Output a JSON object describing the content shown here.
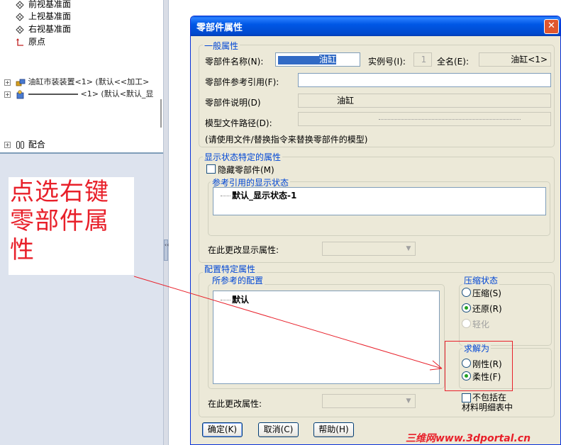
{
  "feature_tree": {
    "items": [
      {
        "label": "前视基准面",
        "icon": "plane-icon"
      },
      {
        "label": "上视基准面",
        "icon": "plane-icon"
      },
      {
        "label": "右视基准面",
        "icon": "plane-icon"
      },
      {
        "label": "原点",
        "icon": "origin-icon"
      }
    ],
    "partial_rows": [
      "油缸市装装置<1> (默认<<加工>",
      "<1> (默认<默认_显"
    ],
    "mates_label": "配合"
  },
  "annotation": {
    "text": "点选右键零部件属性",
    "color": "#e8202a"
  },
  "watermark": "三维网www.3dportal.cn",
  "dialog": {
    "title": "零部件属性",
    "general": {
      "legend": "一般属性",
      "name_label": "零部件名称(N):",
      "name_value": "油缸",
      "instance_label": "实例号(I):",
      "instance_value": "1",
      "fullname_label": "全名(E):",
      "fullname_value": "油缸<1>",
      "ref_label": "零部件参考引用(F):",
      "ref_value": "",
      "desc_label": "零部件说明(D)",
      "desc_value": "油缸",
      "path_label": "模型文件路径(D):",
      "path_value": "",
      "note": "(请使用文件/替换指令来替换零部件的模型)"
    },
    "display_state": {
      "legend": "显示状态特定的属性",
      "hide_label": "隐藏零部件(M)",
      "hide_checked": false,
      "ref_list_legend": "参考引用的显示状态",
      "ref_list_items": [
        "默认_显示状态-1"
      ],
      "change_label": "在此更改显示属性:"
    },
    "config": {
      "legend": "配置特定属性",
      "ref_configs_legend": "所参考的配置",
      "ref_configs_items": [
        "默认"
      ],
      "suppress": {
        "legend": "压缩状态",
        "options": [
          {
            "label": "压缩(S)",
            "checked": false,
            "enabled": true
          },
          {
            "label": "还原(R)",
            "checked": true,
            "enabled": true
          },
          {
            "label": "轻化",
            "checked": false,
            "enabled": false
          }
        ]
      },
      "solve_as": {
        "legend": "求解为",
        "options": [
          {
            "label": "刚性(R)",
            "checked": false
          },
          {
            "label": "柔性(F)",
            "checked": true
          }
        ]
      },
      "exclude_bom_label_1": "不包括在",
      "exclude_bom_label_2": "材料明细表中",
      "change_label": "在此更改属性:"
    },
    "buttons": {
      "ok": "确定(K)",
      "cancel": "取消(C)",
      "help": "帮助(H)"
    }
  }
}
